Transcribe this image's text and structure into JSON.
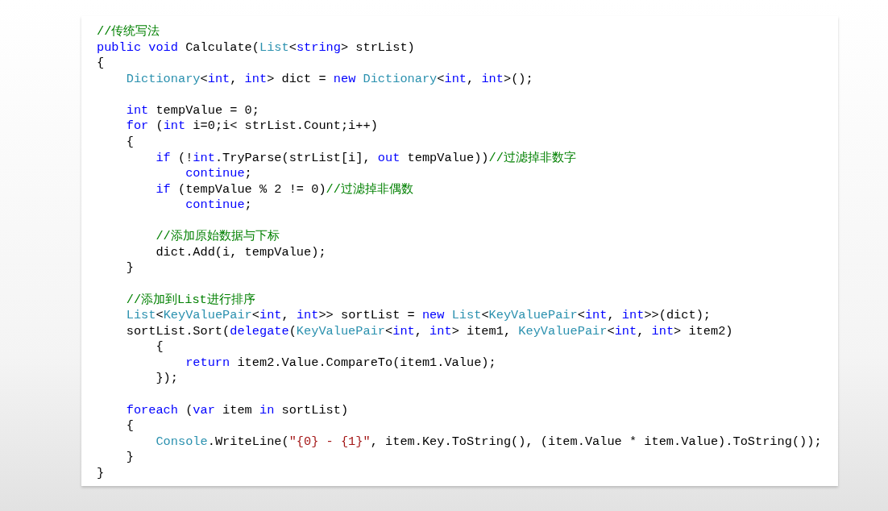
{
  "code_lines": [
    {
      "kind": "code",
      "tokens": [
        {
          "kind": "comment",
          "text": "//传统写法"
        }
      ]
    },
    {
      "kind": "code",
      "tokens": [
        {
          "kind": "keyword",
          "text": "public"
        },
        {
          "kind": "keyword",
          "text": " void"
        },
        {
          "kind": "plain",
          "text": " Calculate("
        },
        {
          "kind": "type",
          "text": "List"
        },
        {
          "kind": "plain",
          "text": "<"
        },
        {
          "kind": "keyword",
          "text": "string"
        },
        {
          "kind": "plain",
          "text": "> strList)"
        }
      ]
    },
    {
      "kind": "code",
      "tokens": [
        {
          "kind": "plain",
          "text": "{"
        }
      ]
    },
    {
      "kind": "code",
      "tokens": [
        {
          "kind": "type",
          "text": "    Dictionary"
        },
        {
          "kind": "plain",
          "text": "<"
        },
        {
          "kind": "keyword",
          "text": "int"
        },
        {
          "kind": "plain",
          "text": ", "
        },
        {
          "kind": "keyword",
          "text": "int"
        },
        {
          "kind": "plain",
          "text": "> dict = "
        },
        {
          "kind": "keyword",
          "text": "new"
        },
        {
          "kind": "type",
          "text": " Dictionary"
        },
        {
          "kind": "plain",
          "text": "<"
        },
        {
          "kind": "keyword",
          "text": "int"
        },
        {
          "kind": "plain",
          "text": ", "
        },
        {
          "kind": "keyword",
          "text": "int"
        },
        {
          "kind": "plain",
          "text": ">();"
        }
      ]
    },
    {
      "kind": "blank"
    },
    {
      "kind": "code",
      "tokens": [
        {
          "kind": "keyword",
          "text": "    int"
        },
        {
          "kind": "plain",
          "text": " tempValue = 0;"
        }
      ]
    },
    {
      "kind": "code",
      "tokens": [
        {
          "kind": "keyword",
          "text": "    for"
        },
        {
          "kind": "plain",
          "text": " ("
        },
        {
          "kind": "keyword",
          "text": "int"
        },
        {
          "kind": "plain",
          "text": " i=0;i< strList.Count;i++)"
        }
      ]
    },
    {
      "kind": "code",
      "tokens": [
        {
          "kind": "plain",
          "text": "    {"
        }
      ]
    },
    {
      "kind": "code",
      "tokens": [
        {
          "kind": "keyword",
          "text": "        if"
        },
        {
          "kind": "plain",
          "text": " (!"
        },
        {
          "kind": "keyword",
          "text": "int"
        },
        {
          "kind": "plain",
          "text": ".TryParse(strList[i], "
        },
        {
          "kind": "keyword",
          "text": "out"
        },
        {
          "kind": "plain",
          "text": " tempValue))"
        },
        {
          "kind": "comment",
          "text": "//过滤掉非数字"
        }
      ]
    },
    {
      "kind": "code",
      "tokens": [
        {
          "kind": "keyword",
          "text": "            continue"
        },
        {
          "kind": "plain",
          "text": ";"
        }
      ]
    },
    {
      "kind": "code",
      "tokens": [
        {
          "kind": "keyword",
          "text": "        if"
        },
        {
          "kind": "plain",
          "text": " (tempValue % 2 != 0)"
        },
        {
          "kind": "comment",
          "text": "//过滤掉非偶数"
        }
      ]
    },
    {
      "kind": "code",
      "tokens": [
        {
          "kind": "keyword",
          "text": "            continue"
        },
        {
          "kind": "plain",
          "text": ";"
        }
      ]
    },
    {
      "kind": "blank"
    },
    {
      "kind": "code",
      "tokens": [
        {
          "kind": "comment",
          "text": "        //添加原始数据与下标"
        }
      ]
    },
    {
      "kind": "code",
      "tokens": [
        {
          "kind": "plain",
          "text": "        dict.Add(i, tempValue);"
        }
      ]
    },
    {
      "kind": "code",
      "tokens": [
        {
          "kind": "plain",
          "text": "    }"
        }
      ]
    },
    {
      "kind": "blank"
    },
    {
      "kind": "code",
      "tokens": [
        {
          "kind": "comment",
          "text": "    //添加到List进行排序"
        }
      ]
    },
    {
      "kind": "code",
      "tokens": [
        {
          "kind": "type",
          "text": "    List"
        },
        {
          "kind": "plain",
          "text": "<"
        },
        {
          "kind": "type",
          "text": "KeyValuePair"
        },
        {
          "kind": "plain",
          "text": "<"
        },
        {
          "kind": "keyword",
          "text": "int"
        },
        {
          "kind": "plain",
          "text": ", "
        },
        {
          "kind": "keyword",
          "text": "int"
        },
        {
          "kind": "plain",
          "text": ">> sortList = "
        },
        {
          "kind": "keyword",
          "text": "new"
        },
        {
          "kind": "type",
          "text": " List"
        },
        {
          "kind": "plain",
          "text": "<"
        },
        {
          "kind": "type",
          "text": "KeyValuePair"
        },
        {
          "kind": "plain",
          "text": "<"
        },
        {
          "kind": "keyword",
          "text": "int"
        },
        {
          "kind": "plain",
          "text": ", "
        },
        {
          "kind": "keyword",
          "text": "int"
        },
        {
          "kind": "plain",
          "text": ">>(dict);"
        }
      ]
    },
    {
      "kind": "code",
      "tokens": [
        {
          "kind": "plain",
          "text": "    sortList.Sort("
        },
        {
          "kind": "keyword",
          "text": "delegate"
        },
        {
          "kind": "plain",
          "text": "("
        },
        {
          "kind": "type",
          "text": "KeyValuePair"
        },
        {
          "kind": "plain",
          "text": "<"
        },
        {
          "kind": "keyword",
          "text": "int"
        },
        {
          "kind": "plain",
          "text": ", "
        },
        {
          "kind": "keyword",
          "text": "int"
        },
        {
          "kind": "plain",
          "text": "> item1, "
        },
        {
          "kind": "type",
          "text": "KeyValuePair"
        },
        {
          "kind": "plain",
          "text": "<"
        },
        {
          "kind": "keyword",
          "text": "int"
        },
        {
          "kind": "plain",
          "text": ", "
        },
        {
          "kind": "keyword",
          "text": "int"
        },
        {
          "kind": "plain",
          "text": "> item2)"
        }
      ]
    },
    {
      "kind": "code",
      "tokens": [
        {
          "kind": "plain",
          "text": "        {"
        }
      ]
    },
    {
      "kind": "code",
      "tokens": [
        {
          "kind": "keyword",
          "text": "            return"
        },
        {
          "kind": "plain",
          "text": " item2.Value.CompareTo(item1.Value);"
        }
      ]
    },
    {
      "kind": "code",
      "tokens": [
        {
          "kind": "plain",
          "text": "        });"
        }
      ]
    },
    {
      "kind": "blank"
    },
    {
      "kind": "code",
      "tokens": [
        {
          "kind": "keyword",
          "text": "    foreach"
        },
        {
          "kind": "plain",
          "text": " ("
        },
        {
          "kind": "keyword",
          "text": "var"
        },
        {
          "kind": "plain",
          "text": " item "
        },
        {
          "kind": "keyword",
          "text": "in"
        },
        {
          "kind": "plain",
          "text": " sortList)"
        }
      ]
    },
    {
      "kind": "code",
      "tokens": [
        {
          "kind": "plain",
          "text": "    {"
        }
      ]
    },
    {
      "kind": "code",
      "tokens": [
        {
          "kind": "type",
          "text": "        Console"
        },
        {
          "kind": "plain",
          "text": ".WriteLine("
        },
        {
          "kind": "string",
          "text": "\"{0} - {1}\""
        },
        {
          "kind": "plain",
          "text": ", item.Key.ToString(), (item.Value * item.Value).ToString());"
        }
      ]
    },
    {
      "kind": "code",
      "tokens": [
        {
          "kind": "plain",
          "text": "    }"
        }
      ]
    },
    {
      "kind": "code",
      "tokens": [
        {
          "kind": "plain",
          "text": "}"
        }
      ]
    }
  ]
}
